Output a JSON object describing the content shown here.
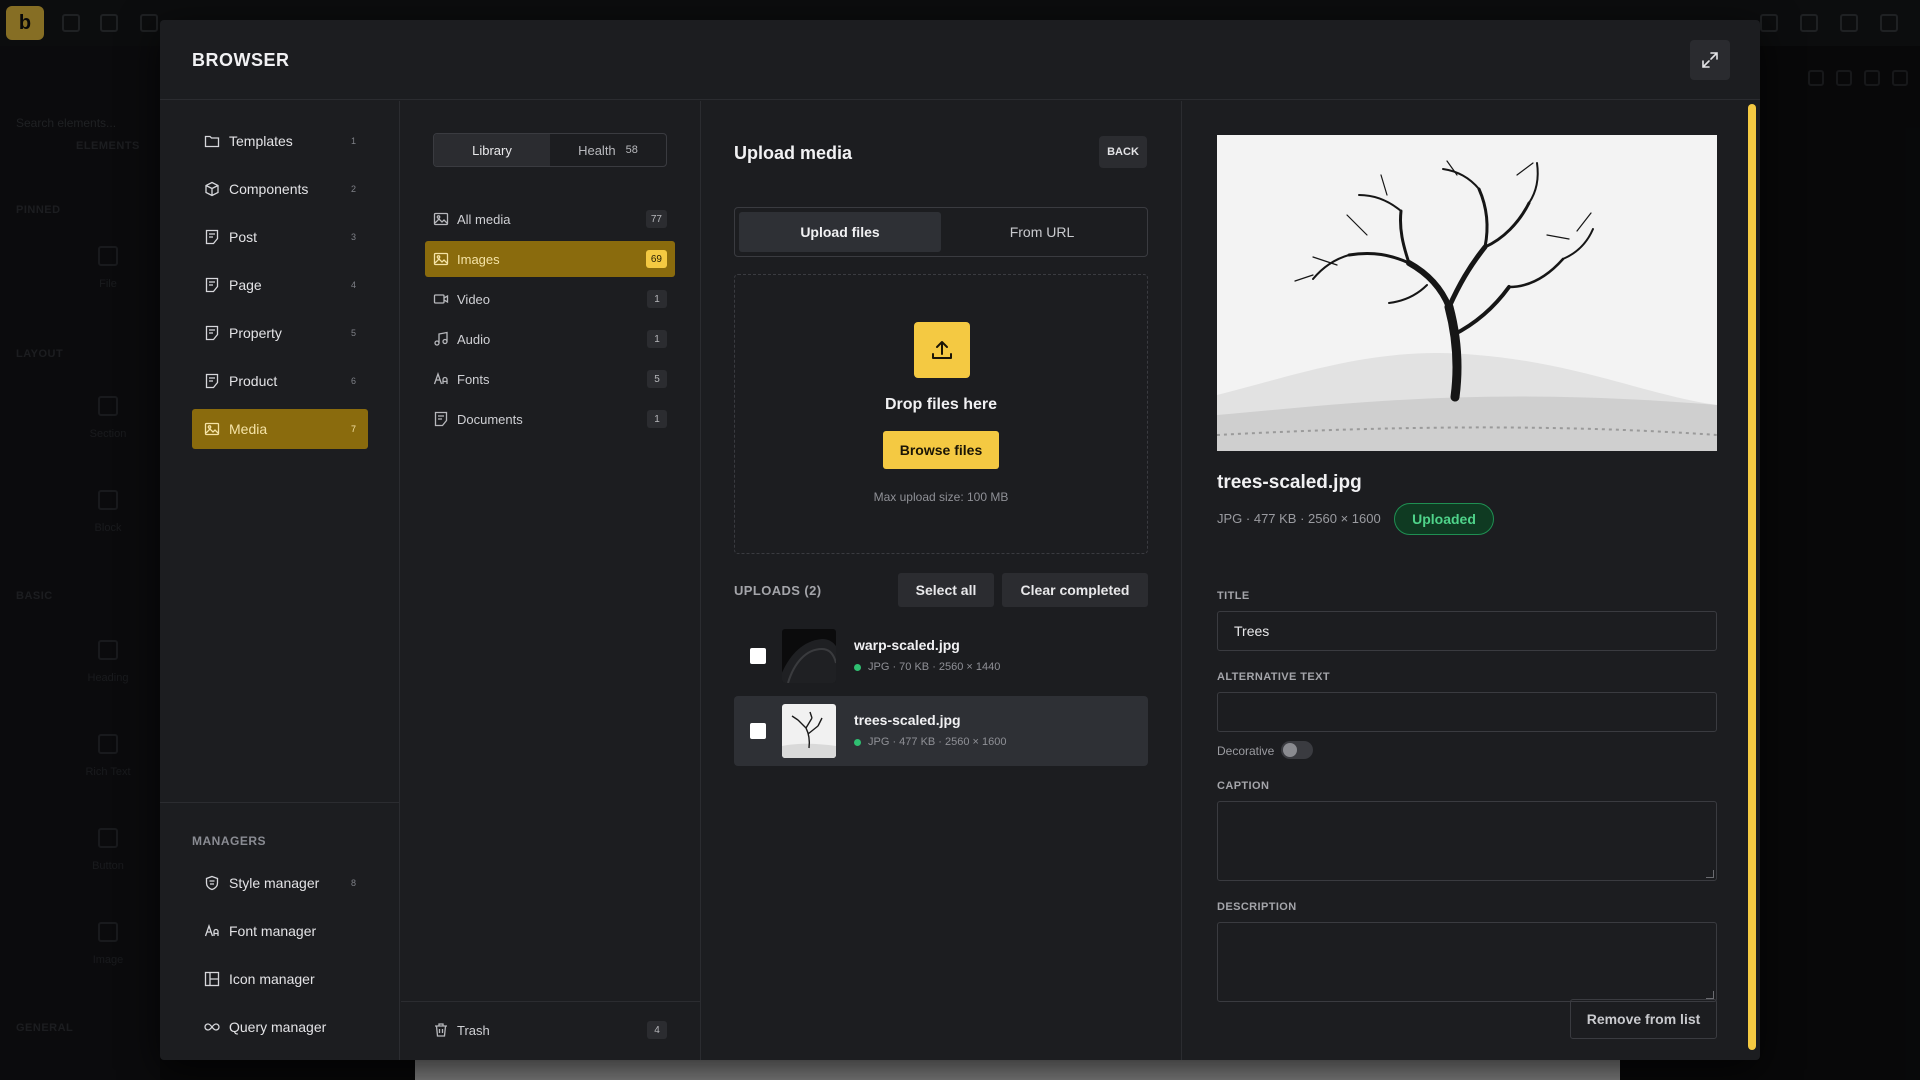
{
  "background": {
    "logo": "b",
    "search_placeholder": "Search elements...",
    "sections": [
      "ELEMENTS",
      "PINNED",
      "LAYOUT",
      "BASIC",
      "GENERAL"
    ],
    "items": [
      "File",
      "Section",
      "Block",
      "Heading",
      "Rich Text",
      "Button",
      "Image"
    ]
  },
  "modal": {
    "title": "BROWSER"
  },
  "nav": {
    "items": [
      {
        "label": "Templates",
        "count": "1",
        "icon": "folder-icon"
      },
      {
        "label": "Components",
        "count": "2",
        "icon": "cube-icon"
      },
      {
        "label": "Post",
        "count": "3",
        "icon": "document-icon"
      },
      {
        "label": "Page",
        "count": "4",
        "icon": "document-icon"
      },
      {
        "label": "Property",
        "count": "5",
        "icon": "document-icon"
      },
      {
        "label": "Product",
        "count": "6",
        "icon": "document-icon"
      },
      {
        "label": "Media",
        "count": "7",
        "icon": "image-icon",
        "active": true
      }
    ],
    "managers_title": "MANAGERS",
    "managers": [
      {
        "label": "Style manager",
        "count": "8",
        "icon": "shield-icon"
      },
      {
        "label": "Font manager",
        "count": "",
        "icon": "font-icon"
      },
      {
        "label": "Icon manager",
        "count": "",
        "icon": "grid-icon"
      },
      {
        "label": "Query manager",
        "count": "",
        "icon": "infinity-icon"
      }
    ]
  },
  "library": {
    "tabs": [
      {
        "label": "Library",
        "count": ""
      },
      {
        "label": "Health",
        "count": "58"
      }
    ],
    "categories": [
      {
        "label": "All media",
        "count": "77",
        "icon": "image-icon"
      },
      {
        "label": "Images",
        "count": "69",
        "icon": "image-icon",
        "active": true
      },
      {
        "label": "Video",
        "count": "1",
        "icon": "video-icon"
      },
      {
        "label": "Audio",
        "count": "1",
        "icon": "music-icon"
      },
      {
        "label": "Fonts",
        "count": "5",
        "icon": "font-icon"
      },
      {
        "label": "Documents",
        "count": "1",
        "icon": "document-icon"
      }
    ],
    "trash": {
      "label": "Trash",
      "count": "4"
    }
  },
  "upload": {
    "title": "Upload media",
    "back_label": "BACK",
    "modes": [
      {
        "label": "Upload files",
        "active": true
      },
      {
        "label": "From URL",
        "active": false
      }
    ],
    "drop_text": "Drop files here",
    "browse_label": "Browse files",
    "max_size_text": "Max upload size: 100 MB",
    "uploads_title": "UPLOADS (2)",
    "select_all_label": "Select all",
    "clear_completed_label": "Clear completed",
    "files": [
      {
        "name": "warp-scaled.jpg",
        "meta": "JPG · 70 KB · 2560 × 1440",
        "status_color": "#2fbf71"
      },
      {
        "name": "trees-scaled.jpg",
        "meta": "JPG · 477 KB · 2560 × 1600",
        "status_color": "#2fbf71",
        "selected": true
      }
    ]
  },
  "details": {
    "filename": "trees-scaled.jpg",
    "meta": "JPG · 477 KB · 2560 × 1600",
    "status": "Uploaded",
    "title_label": "TITLE",
    "title_value": "Trees",
    "alt_label": "ALTERNATIVE TEXT",
    "alt_value": "",
    "decorative_label": "Decorative",
    "decorative_on": false,
    "caption_label": "CAPTION",
    "description_label": "DESCRIPTION",
    "remove_label": "Remove from list"
  },
  "colors": {
    "accent": "#f4c942",
    "accent_dark": "#8a6b0d",
    "success": "#2fbf71",
    "panel": "#1c1d20"
  }
}
